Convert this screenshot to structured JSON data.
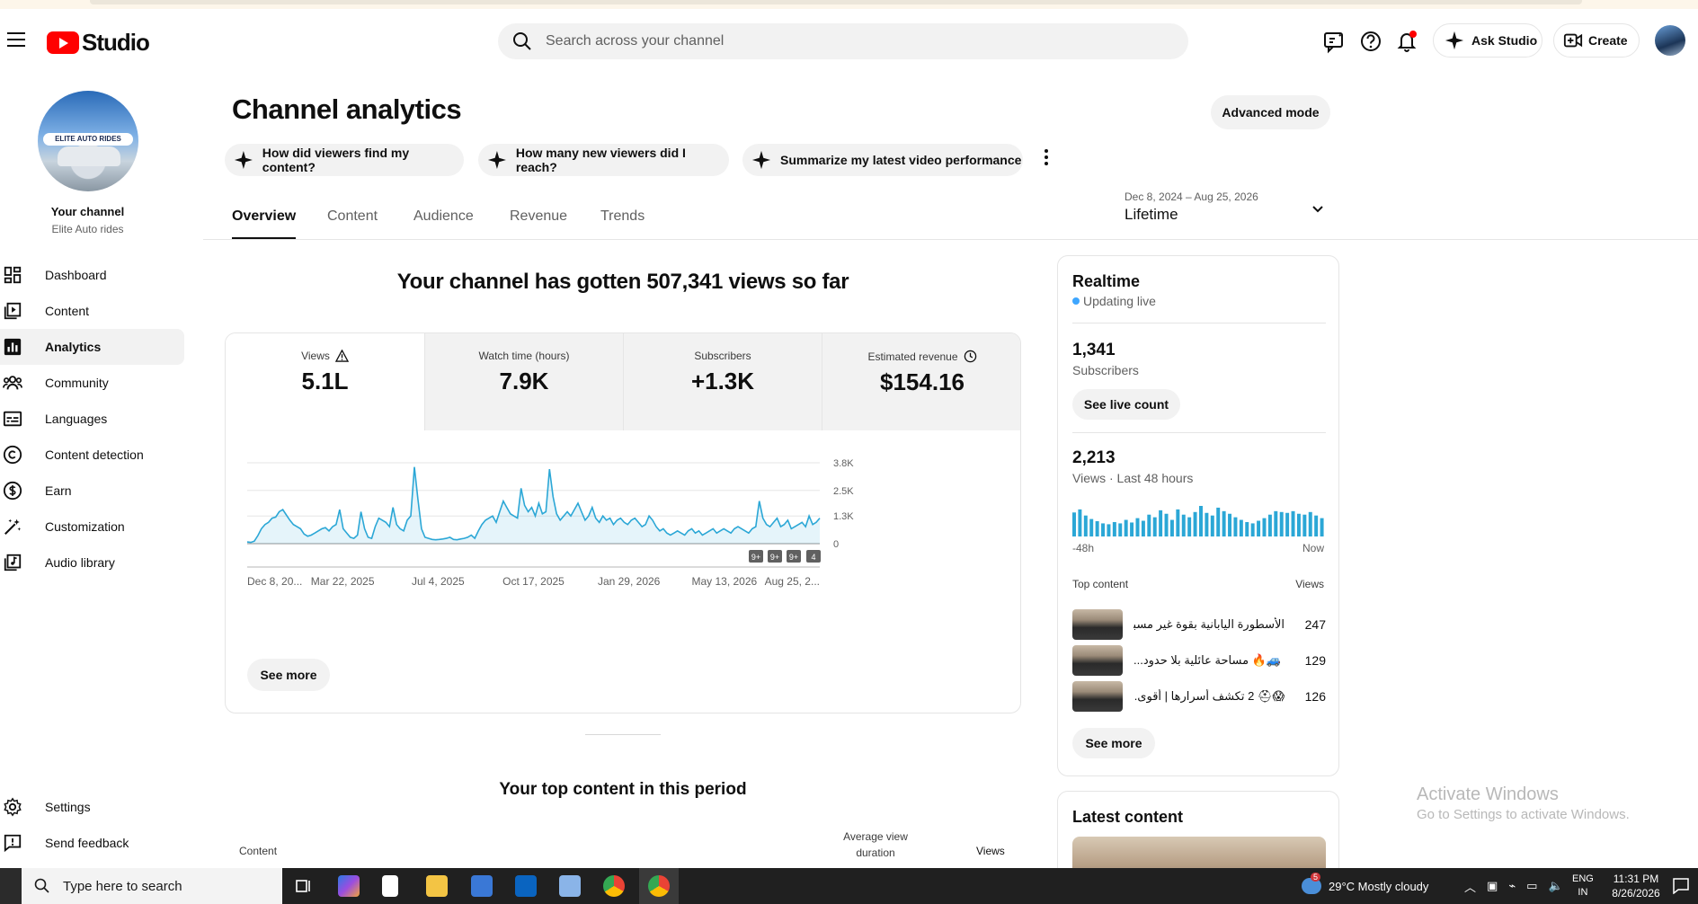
{
  "header": {
    "logo_text": "Studio",
    "search_placeholder": "Search across your channel",
    "ask_label": "Ask Studio",
    "create_label": "Create"
  },
  "sidebar": {
    "your_channel": "Your channel",
    "channel_name": "Elite Auto rides",
    "avatar_brand": "ELITE AUTO RIDES",
    "items": [
      {
        "label": "Dashboard",
        "icon": "dashboard-icon"
      },
      {
        "label": "Content",
        "icon": "content-icon"
      },
      {
        "label": "Analytics",
        "icon": "analytics-icon",
        "active": true
      },
      {
        "label": "Community",
        "icon": "community-icon"
      },
      {
        "label": "Languages",
        "icon": "languages-icon"
      },
      {
        "label": "Content detection",
        "icon": "copyright-icon"
      },
      {
        "label": "Earn",
        "icon": "earn-icon"
      },
      {
        "label": "Customization",
        "icon": "customization-icon"
      },
      {
        "label": "Audio library",
        "icon": "audio-library-icon"
      }
    ],
    "bottom": [
      {
        "label": "Settings",
        "icon": "gear-icon"
      },
      {
        "label": "Send feedback",
        "icon": "feedback-icon"
      }
    ]
  },
  "main": {
    "title": "Channel analytics",
    "advanced_mode": "Advanced mode",
    "chips": [
      "How did viewers find my content?",
      "How many new viewers did I reach?",
      "Summarize my latest video performance"
    ],
    "tabs": [
      "Overview",
      "Content",
      "Audience",
      "Revenue",
      "Trends"
    ],
    "date_range": "Dec 8, 2024 – Aug 25, 2026",
    "date_preset": "Lifetime",
    "headline": "Your channel has gotten 507,341 views so far",
    "metrics": [
      {
        "label": "Views",
        "value": "5.1L"
      },
      {
        "label": "Watch time (hours)",
        "value": "7.9K"
      },
      {
        "label": "Subscribers",
        "value": "+1.3K"
      },
      {
        "label": "Estimated revenue",
        "value": "$154.16"
      }
    ],
    "see_more": "See more",
    "top_content_heading": "Your top content in this period",
    "table_headers": {
      "content": "Content",
      "avg_line1": "Average view",
      "avg_line2": "duration",
      "views": "Views"
    }
  },
  "chart_data": {
    "type": "area",
    "series": [
      {
        "values": [
          80,
          60,
          120,
          380,
          700,
          900,
          1000,
          1200,
          1250,
          1500,
          1600,
          1350,
          1100,
          900,
          800,
          700,
          450,
          350,
          400,
          500,
          600,
          700,
          750,
          600,
          800,
          900,
          1600,
          700,
          500,
          300,
          250,
          400,
          1500,
          700,
          300,
          250,
          800,
          1200,
          1100,
          1000,
          800,
          1700,
          900,
          700,
          600,
          1100,
          1300,
          3600,
          2100,
          700,
          300,
          250,
          200,
          180,
          200,
          220,
          250,
          300,
          200,
          180,
          220,
          250,
          300,
          400,
          250,
          600,
          900,
          1100,
          1200,
          1300,
          1000,
          1500,
          2000,
          1700,
          1400,
          1300,
          1200,
          2600,
          1800,
          1500,
          1700,
          1300,
          1900,
          1400,
          1500,
          3500,
          2200,
          1400,
          1100,
          1300,
          1500,
          1300,
          1600,
          1900,
          1500,
          1100,
          1300,
          1700,
          1200,
          1000,
          1300,
          1100,
          1200,
          900,
          1100,
          1200,
          1000,
          900,
          1100,
          1200,
          1000,
          800,
          900,
          1300,
          1100,
          800,
          600,
          700,
          500,
          400,
          500,
          600,
          500,
          400,
          600,
          700,
          500,
          600,
          400,
          500,
          600,
          700,
          500,
          600,
          700,
          600,
          500,
          700,
          800,
          700,
          600,
          500,
          700,
          800,
          2000,
          1200,
          900,
          800,
          1000,
          1200,
          800,
          900,
          1100,
          700,
          800,
          900,
          1000,
          800,
          1300,
          900,
          1000,
          1200
        ]
      }
    ],
    "x_tick_labels": [
      "Dec 8, 20...",
      "Mar 22, 2025",
      "Jul 4, 2025",
      "Oct 17, 2025",
      "Jan 29, 2026",
      "May 13, 2026",
      "Aug 25, 2..."
    ],
    "y_tick_labels": [
      "3.8K",
      "2.5K",
      "1.3K",
      "0"
    ],
    "ylim": [
      0,
      3800
    ],
    "grid": true,
    "markers": [
      "9+",
      "9+",
      "9+",
      "4"
    ],
    "color": "#2ba7d6"
  },
  "realtime": {
    "title": "Realtime",
    "live": "Updating live",
    "subs_value": "1,341",
    "subs_label": "Subscribers",
    "see_live": "See live count",
    "views_value": "2,213",
    "views_label": "Views · Last 48 hours",
    "axis_start": "-48h",
    "axis_end": "Now",
    "top_content": "Top content",
    "views_col": "Views",
    "hourly_views": [
      55,
      62,
      48,
      40,
      35,
      30,
      28,
      33,
      30,
      38,
      32,
      42,
      36,
      50,
      44,
      60,
      52,
      38,
      62,
      50,
      44,
      56,
      70,
      54,
      48,
      66,
      58,
      52,
      44,
      38,
      33,
      30,
      36,
      42,
      50,
      58,
      56,
      54,
      58,
      52,
      50,
      56,
      48,
      42
    ],
    "rows": [
      {
        "title": "الأسطورة اليابانية بقوة غير مسبوقة...",
        "views": "247"
      },
      {
        "title": "🚙🔥 مساحة عائلية بلا حدود...",
        "views": "129"
      },
      {
        "title": "😱⛑ 2 تكشف أسرارها | أقوى...",
        "views": "126"
      }
    ],
    "see_more": "See more"
  },
  "latest": {
    "title": "Latest content"
  },
  "watermark": {
    "line1": "Activate Windows",
    "line2": "Go to Settings to activate Windows."
  },
  "taskbar": {
    "search": "Type here to search",
    "weather": "29°C  Mostly cloudy",
    "lang1": "ENG",
    "lang2": "IN",
    "time": "11:31 PM",
    "date": "8/26/2026",
    "badge": "5"
  }
}
